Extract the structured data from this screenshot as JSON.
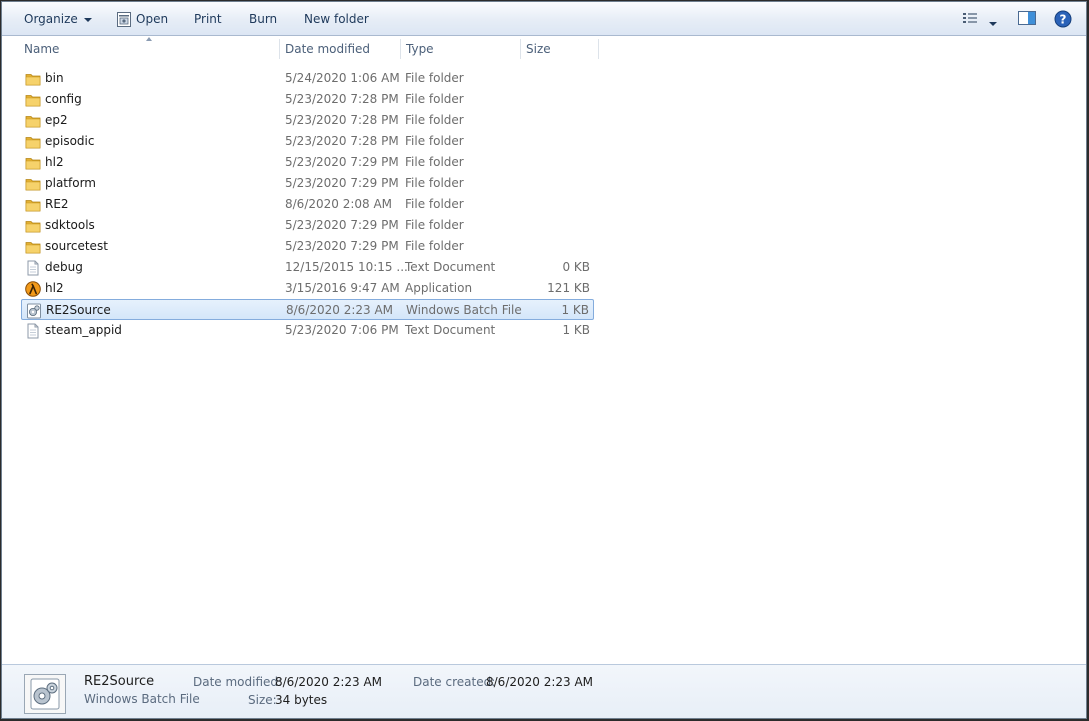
{
  "toolbar": {
    "organize": "Organize",
    "open": "Open",
    "print": "Print",
    "burn": "Burn",
    "new_folder": "New folder",
    "views_icon": "view-options-icon",
    "preview_pane_icon": "preview-pane-icon",
    "help_icon": "help-icon"
  },
  "columns": {
    "name": "Name",
    "date": "Date modified",
    "type": "Type",
    "size": "Size"
  },
  "files": [
    {
      "name": "bin",
      "date": "5/24/2020 1:06 AM",
      "type": "File folder",
      "size": "",
      "icon": "folder-icon"
    },
    {
      "name": "config",
      "date": "5/23/2020 7:28 PM",
      "type": "File folder",
      "size": "",
      "icon": "folder-icon"
    },
    {
      "name": "ep2",
      "date": "5/23/2020 7:28 PM",
      "type": "File folder",
      "size": "",
      "icon": "folder-icon"
    },
    {
      "name": "episodic",
      "date": "5/23/2020 7:28 PM",
      "type": "File folder",
      "size": "",
      "icon": "folder-icon"
    },
    {
      "name": "hl2",
      "date": "5/23/2020 7:29 PM",
      "type": "File folder",
      "size": "",
      "icon": "folder-icon"
    },
    {
      "name": "platform",
      "date": "5/23/2020 7:29 PM",
      "type": "File folder",
      "size": "",
      "icon": "folder-icon"
    },
    {
      "name": "RE2",
      "date": "8/6/2020 2:08 AM",
      "type": "File folder",
      "size": "",
      "icon": "folder-icon"
    },
    {
      "name": "sdktools",
      "date": "5/23/2020 7:29 PM",
      "type": "File folder",
      "size": "",
      "icon": "folder-icon"
    },
    {
      "name": "sourcetest",
      "date": "5/23/2020 7:29 PM",
      "type": "File folder",
      "size": "",
      "icon": "folder-icon"
    },
    {
      "name": "debug",
      "date": "12/15/2015 10:15 ...",
      "type": "Text Document",
      "size": "0 KB",
      "icon": "text-document-icon"
    },
    {
      "name": "hl2",
      "date": "3/15/2016 9:47 AM",
      "type": "Application",
      "size": "121 KB",
      "icon": "half-life-app-icon"
    },
    {
      "name": "RE2Source",
      "date": "8/6/2020 2:23 AM",
      "type": "Windows Batch File",
      "size": "1 KB",
      "icon": "batch-file-icon",
      "selected": true
    },
    {
      "name": "steam_appid",
      "date": "5/23/2020 7:06 PM",
      "type": "Text Document",
      "size": "1 KB",
      "icon": "text-document-icon"
    }
  ],
  "details": {
    "name": "RE2Source",
    "type": "Windows Batch File",
    "date_modified_label": "Date modified:",
    "date_modified": "8/6/2020 2:23 AM",
    "date_created_label": "Date created:",
    "date_created": "8/6/2020 2:23 AM",
    "size_label": "Size:",
    "size": "34 bytes"
  },
  "colors": {
    "selection_bg": "#d9e8fb",
    "selection_border": "#84acdd",
    "folder": "#e8b93a",
    "toolbar_text": "#1e395b"
  }
}
